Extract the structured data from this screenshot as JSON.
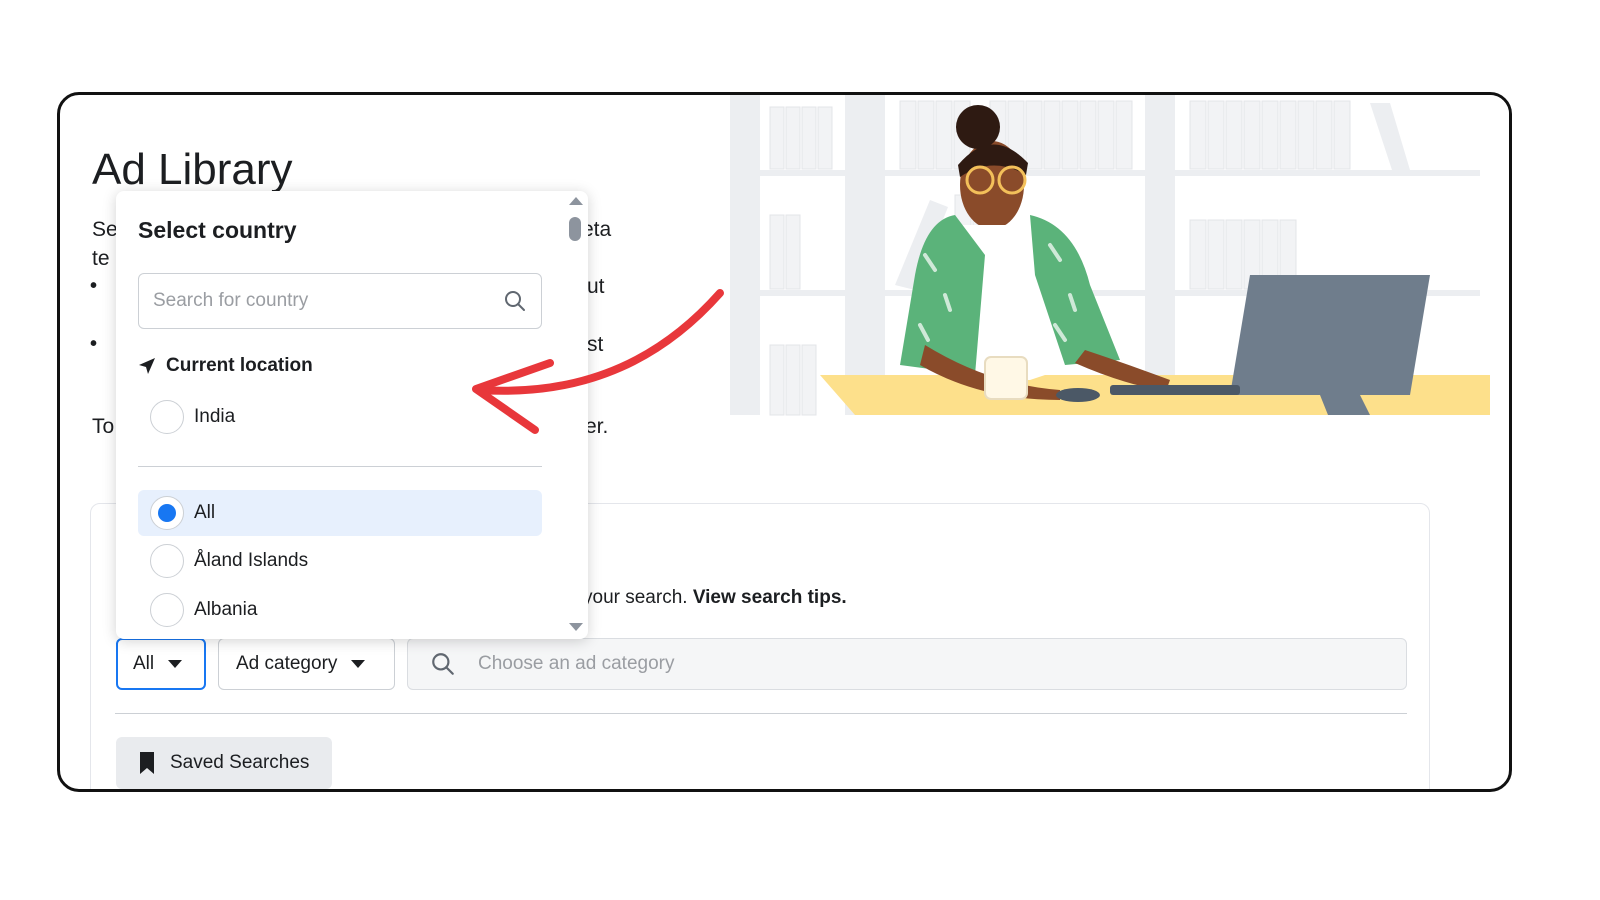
{
  "page": {
    "title": "Ad Library",
    "intro_fragments": {
      "line1_left": "Se",
      "line1_right": "eta",
      "line2_left": "te",
      "line3_right": "ut",
      "line4_right": "st",
      "line5_left": "To",
      "line5_right": "er."
    },
    "hint_text": "your search.",
    "hint_link": "View search tips."
  },
  "country_dropdown": {
    "title": "Select country",
    "search_placeholder": "Search for country",
    "current_location_label": "Current location",
    "current_location_value": "India",
    "options": [
      {
        "label": "All",
        "selected": true
      },
      {
        "label": "Åland Islands",
        "selected": false
      },
      {
        "label": "Albania",
        "selected": false
      }
    ]
  },
  "filters": {
    "country_button_label": "All",
    "category_button_label": "Ad category",
    "category_search_placeholder": "Choose an ad category"
  },
  "saved_searches_label": "Saved Searches",
  "colors": {
    "accent": "#1877f2",
    "annotation_arrow": "#e8373b",
    "selected_row": "#e7f0fd",
    "desk": "#fde08b",
    "laptop": "#6f7d8c",
    "jacket": "#5bb37a"
  },
  "icons": [
    "search-icon",
    "location-arrow-icon",
    "bookmark-icon",
    "caret-down-icon"
  ]
}
